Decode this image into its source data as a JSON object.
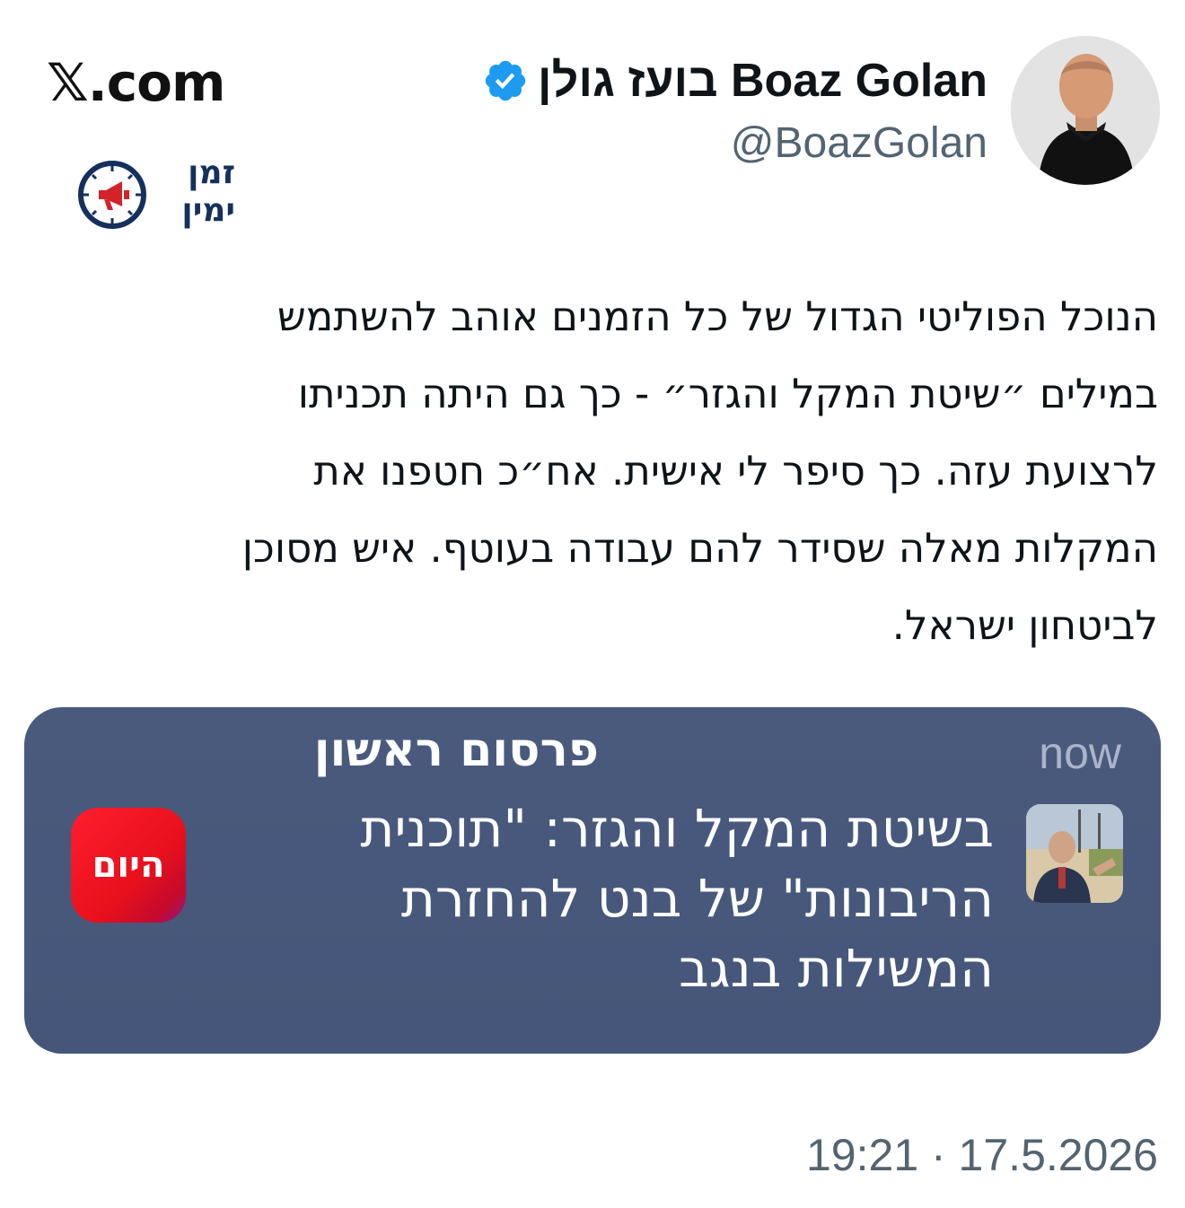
{
  "site_label": "𝕏.com",
  "brand_logo": {
    "line1": "זמן",
    "line2": "ימין"
  },
  "author": {
    "display_name": "בועז גולן Boaz Golan",
    "handle": "@BoazGolan",
    "verified": true
  },
  "tweet_lines": [
    "הנוכל הפוליטי הגדול של כל הזמנים אוהב להשתמש",
    "במילים ״שיטת המקל והגזר״ - כך גם היתה תכניתו",
    "לרצועת עזה. כך סיפר לי אישית. אח״כ חטפנו את",
    "המקלות מאלה שסידר להם עבודה בעוטף. איש מסוכן",
    "לביטחון ישראל."
  ],
  "notification": {
    "title": "פרסום ראשון",
    "time": "now",
    "app_name": "היום",
    "body_lines": [
      "בשיטת המקל והגזר: \"תוכנית",
      "הריבונות\" של בנט להחזרת",
      "המשילות בנגב"
    ]
  },
  "timestamp": "19:21 · 17.5.2026",
  "colors": {
    "notification_bg": "#46567a",
    "verified_blue": "#1d9bf0",
    "app_icon_red": "#e8101c",
    "logo_navy": "#16305e",
    "logo_red": "#d2232a"
  }
}
